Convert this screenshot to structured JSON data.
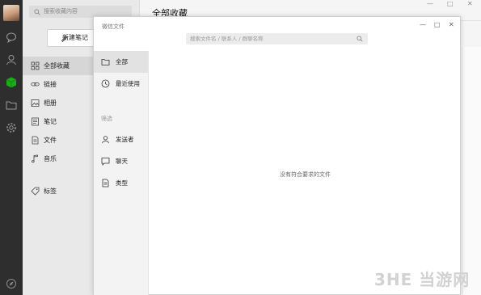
{
  "app": {
    "main_title": "全部收藏",
    "window_controls": [
      "—",
      "□",
      "✕"
    ]
  },
  "favorites": {
    "search_placeholder": "搜索收藏内容",
    "new_note_label": "新建笔记",
    "items": [
      {
        "label": "全部收藏",
        "icon": "grid-icon",
        "active": true
      },
      {
        "label": "链接",
        "icon": "link-icon"
      },
      {
        "label": "相册",
        "icon": "image-icon"
      },
      {
        "label": "笔记",
        "icon": "note-icon"
      },
      {
        "label": "文件",
        "icon": "file-icon"
      },
      {
        "label": "音乐",
        "icon": "music-icon"
      },
      {
        "label": "标签",
        "icon": "tag-icon"
      }
    ]
  },
  "dialog": {
    "title": "微信文件",
    "search_placeholder": "搜索文件名 / 联系人 / 群聊名称",
    "nav_items": [
      {
        "label": "全部",
        "icon": "folder-icon",
        "active": true
      },
      {
        "label": "最近使用",
        "icon": "clock-icon"
      }
    ],
    "filter_section": "筛选",
    "filter_items": [
      {
        "label": "发送者",
        "icon": "person-icon"
      },
      {
        "label": "聊天",
        "icon": "chat-icon"
      },
      {
        "label": "类型",
        "icon": "document-icon"
      }
    ],
    "empty_message": "没有符合要求的文件",
    "controls": [
      "—",
      "□",
      "✕"
    ]
  },
  "watermark": "3HE 当游网",
  "colors": {
    "rail": "#2e2e2e",
    "sidebar": "#e9e9e9",
    "accent_green": "#1aad19"
  }
}
